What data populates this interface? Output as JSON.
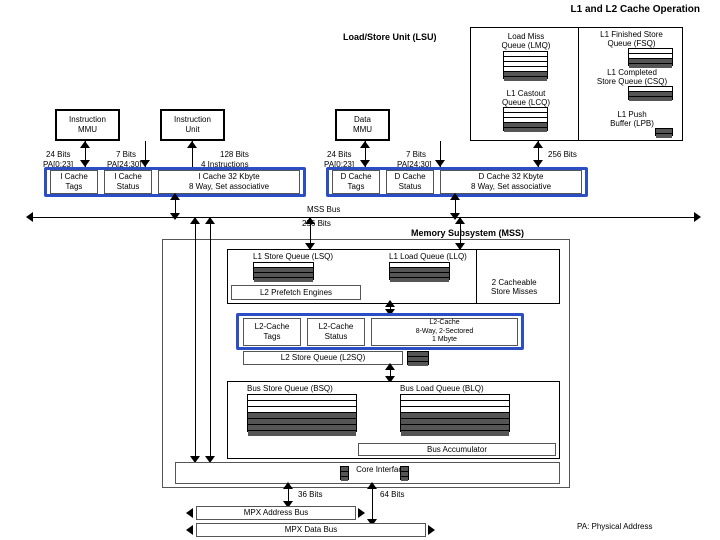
{
  "page_title": "L1 and L2 Cache Operation",
  "lsu": {
    "title": "Load/Store Unit (LSU)",
    "lmq": {
      "title": "Load Miss",
      "sub": "Queue (LMQ)"
    },
    "lcq": {
      "title": "L1 Castout",
      "sub": "Queue (LCQ)"
    },
    "fsq": {
      "title": "L1 Finished Store",
      "sub": "Queue (FSQ)"
    },
    "csq": {
      "title": "L1 Completed",
      "sub": "Store Queue (CSQ)"
    },
    "lpb": {
      "title": "L1 Push",
      "sub": "Buffer (LPB)"
    }
  },
  "top_row": {
    "instr_mmu": "Instruction\nMMU",
    "instr_unit": "Instruction\nUnit",
    "data_mmu": "Data\nMMU"
  },
  "labels": {
    "b24_left": "24 Bits",
    "pa023_left": "PA[0:23]",
    "b7_left": "7 Bits",
    "pa2430_left": "PA[24:30]",
    "b128": "128 Bits",
    "instr4": "4 Instructions",
    "b24_right": "24 Bits",
    "pa023_right": "PA[0:23]",
    "b7_right": "7 Bits",
    "pa2430_right": "PA[24:30]",
    "b256": "256 Bits",
    "mss_bus": "MSS Bus",
    "b256_2": "256 Bits",
    "b36": "36 Bits",
    "b64": "64 Bits",
    "mpx_addr": "MPX Address Bus",
    "mpx_data": "MPX Data Bus",
    "pa_note": "PA: Physical Address",
    "core_if": "Core Interface"
  },
  "icache": {
    "tags": "I Cache\nTags",
    "status": "I Cache\nStatus",
    "main": "I Cache  32 Kbyte\n8 Way, Set associative"
  },
  "dcache": {
    "tags": "D Cache\nTags",
    "status": "D Cache\nStatus",
    "main": "D Cache  32 Kbyte\n8 Way, Set associative"
  },
  "mss": {
    "title": "Memory Subsystem (MSS)",
    "lsq": "L1 Store Queue (LSQ)",
    "llq": "L1 Load Queue (LLQ)",
    "pfe": "L2 Prefetch Engines",
    "csm": "2 Cacheable\nStore Misses",
    "l2tags": "L2-Cache\nTags",
    "l2status": "L2-Cache\nStatus",
    "l2main": "L2-Cache\n8-Way, 2-Sectored\n1 Mbyte",
    "l2sq": "L2 Store Queue (L2SQ)",
    "bsq": "Bus Store Queue (BSQ)",
    "blq": "Bus Load Queue (BLQ)",
    "accum": "Bus Accumulator"
  }
}
